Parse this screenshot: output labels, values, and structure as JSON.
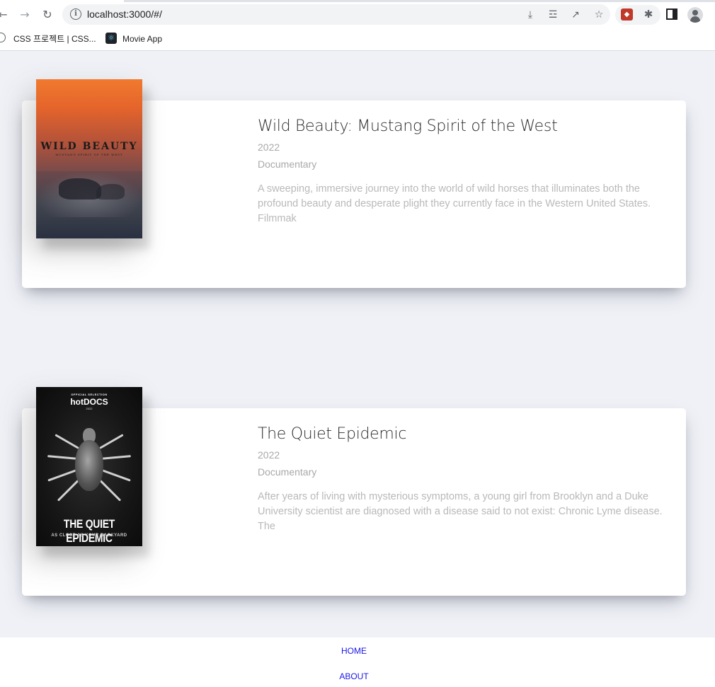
{
  "browser": {
    "url": "localhost:3000/#/",
    "bookmarks": [
      {
        "label": "CSS 프로젝트 | CSS..."
      },
      {
        "label": "Movie App"
      }
    ]
  },
  "movies": [
    {
      "title": "Wild Beauty: Mustang Spirit of the West",
      "year": "2022",
      "genre": "Documentary",
      "summary": "A sweeping, immersive journey into the world of wild horses that illuminates both the profound beauty and desperate plight they currently face in the Western United States. Filmmak",
      "poster": {
        "title": "WILD BEAUTY",
        "subtitle": "MUSTANG SPIRIT OF THE WEST"
      }
    },
    {
      "title": "The Quiet Epidemic",
      "year": "2022",
      "genre": "Documentary",
      "summary": "After years of living with mysterious symptoms, a young girl from Brooklyn and a Duke University scientist are diagnosed with a disease said to not exist: Chronic Lyme disease. The",
      "poster": {
        "selection": "OFFICIAL SELECTION",
        "festival": "hotDOCS",
        "festival_year": "2022",
        "title": "THE QUIET EPIDEMIC",
        "tagline": "AS CLOSE AS YOUR BACKYARD"
      }
    }
  ],
  "nav": {
    "home": "HOME",
    "about": "ABOUT"
  },
  "colors": {
    "page_background": "#eff1f6",
    "card_background": "#ffffff",
    "nav_link": "#1a17e6"
  }
}
